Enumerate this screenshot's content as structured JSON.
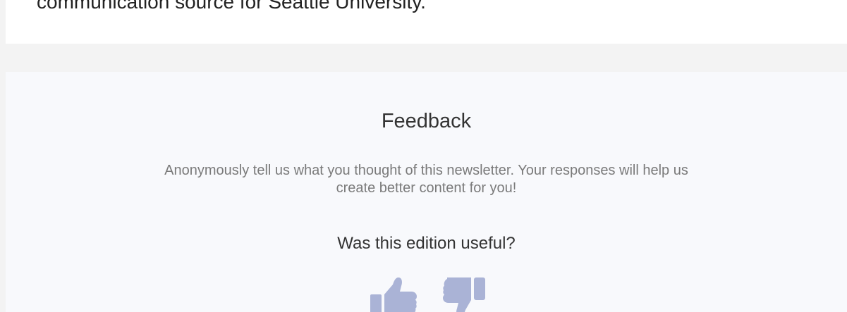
{
  "intro": {
    "text": "communication source for Seattle University."
  },
  "feedback": {
    "title": "Feedback",
    "description": "Anonymously tell us what you thought of this newsletter. Your responses will help us create better content for you!",
    "question": "Was this edition useful?",
    "icon_color": "#aab3d6",
    "thumbs_up_icon": "thumbs-up-icon",
    "thumbs_down_icon": "thumbs-down-icon"
  }
}
